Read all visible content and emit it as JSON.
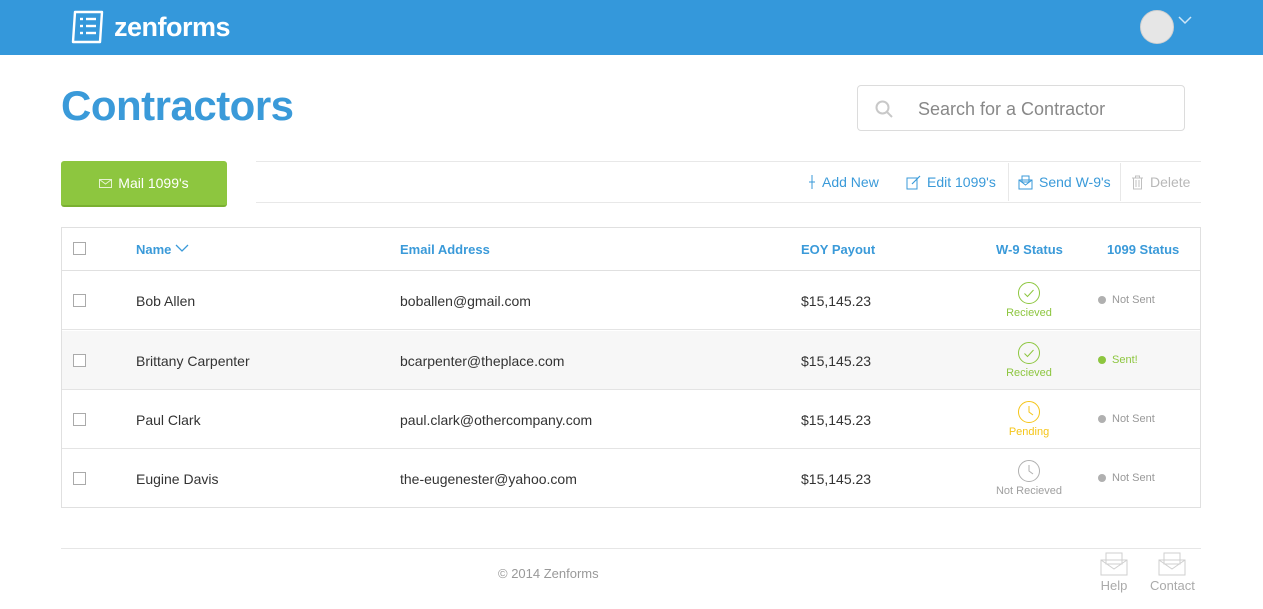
{
  "app": {
    "name": "zenforms",
    "brand_color": "#3498db"
  },
  "header": {
    "logo_text": "zenforms",
    "logo_icon": "document-list-icon",
    "avatar_icon": "avatar-circle",
    "menu_icon": "chevron-down-icon"
  },
  "page": {
    "title": "Contractors"
  },
  "search": {
    "placeholder": "Search for a Contractor",
    "value": "",
    "icon": "search-icon"
  },
  "toolbar": {
    "mail_button": {
      "label": "Mail 1099's",
      "icon": "envelope-icon",
      "color": "#8dc63f"
    },
    "actions": [
      {
        "label": "Add New",
        "icon": "plus-icon",
        "enabled": true
      },
      {
        "label": "Edit 1099's",
        "icon": "edit-icon",
        "enabled": true
      },
      {
        "label": "Send W-9's",
        "icon": "send-icon",
        "enabled": true
      },
      {
        "label": "Delete",
        "icon": "trash-icon",
        "enabled": false
      }
    ]
  },
  "table": {
    "columns": {
      "name": "Name",
      "email": "Email Address",
      "payout": "EOY Payout",
      "w9": "W-9 Status",
      "status1099": "1099 Status"
    },
    "sort": {
      "column": "name",
      "icon": "chevron-down-icon"
    },
    "rows": [
      {
        "name": "Bob Allen",
        "email": "boballen@gmail.com",
        "payout": "$15,145.23",
        "w9": "Recieved",
        "w9_icon": "check-circle-icon",
        "w9_color": "#8dc63f",
        "s1099": "Not Sent",
        "s1099_color": "#b0b0b0"
      },
      {
        "name": "Brittany Carpenter",
        "email": "bcarpenter@theplace.com",
        "payout": "$15,145.23",
        "w9": "Recieved",
        "w9_icon": "check-circle-icon",
        "w9_color": "#8dc63f",
        "s1099": "Sent!",
        "s1099_color": "#8dc63f"
      },
      {
        "name": "Paul Clark",
        "email": "paul.clark@othercompany.com",
        "payout": "$15,145.23",
        "w9": "Pending",
        "w9_icon": "clock-icon",
        "w9_color": "#f5c518",
        "s1099": "Not Sent",
        "s1099_color": "#b0b0b0"
      },
      {
        "name": "Eugine Davis",
        "email": "the-eugenester@yahoo.com",
        "payout": "$15,145.23",
        "w9": "Not Recieved",
        "w9_icon": "clock-icon",
        "w9_color": "#b0b0b0",
        "s1099": "Not Sent",
        "s1099_color": "#b0b0b0"
      }
    ]
  },
  "footer": {
    "copyright": "© 2014 Zenforms",
    "links": [
      {
        "label": "Help",
        "icon": "envelope-icon"
      },
      {
        "label": "Contact",
        "icon": "envelope-icon"
      }
    ]
  }
}
